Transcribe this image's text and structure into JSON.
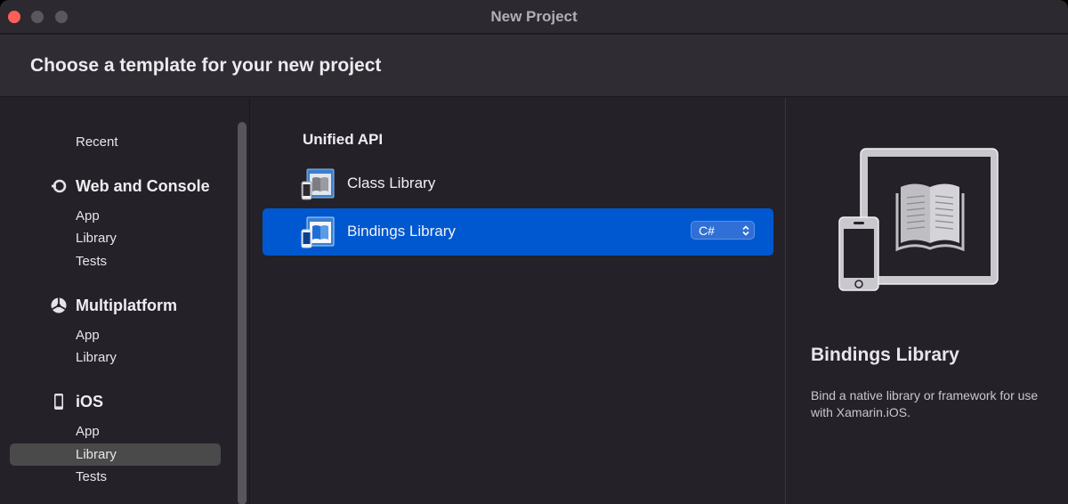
{
  "window": {
    "title": "New Project"
  },
  "header": {
    "title": "Choose a template for your new project"
  },
  "sidebar": {
    "recent": "Recent",
    "categories": [
      {
        "label": "Web and Console",
        "icon": "dotnet-core-icon",
        "items": [
          "App",
          "Library",
          "Tests"
        ]
      },
      {
        "label": "Multiplatform",
        "icon": "multiplatform-icon",
        "items": [
          "App",
          "Library"
        ]
      },
      {
        "label": "iOS",
        "icon": "iphone-icon",
        "items": [
          "App",
          "Library",
          "Tests"
        ]
      }
    ],
    "selected_item": "Library"
  },
  "main": {
    "section_title": "Unified API",
    "templates": [
      {
        "label": "Class Library",
        "icon": "ios-library-icon",
        "selected": false
      },
      {
        "label": "Bindings Library",
        "icon": "ios-library-icon",
        "selected": true,
        "language": "C#"
      }
    ]
  },
  "detail": {
    "title": "Bindings Library",
    "description": "Bind a native library or framework for use with Xamarin.iOS.",
    "icon": "ipad-iphone-book-icon"
  },
  "colors": {
    "accent": "#0058d0",
    "close": "#fe5f57",
    "background": "#242129"
  }
}
